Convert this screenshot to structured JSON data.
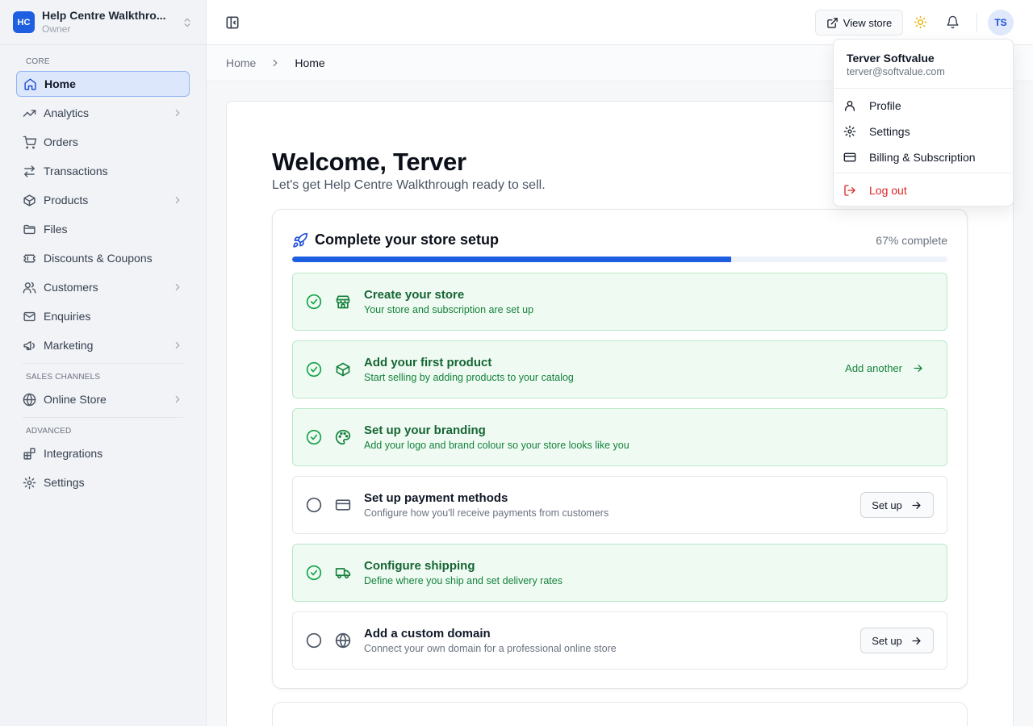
{
  "store": {
    "initials": "HC",
    "name": "Help Centre Walkthro...",
    "role": "Owner"
  },
  "sidebar": {
    "sections": [
      {
        "label": "CORE",
        "items": [
          {
            "label": "Home",
            "icon": "home-icon",
            "active": true,
            "chevron": false
          },
          {
            "label": "Analytics",
            "icon": "trending-up-icon",
            "chevron": true
          },
          {
            "label": "Orders",
            "icon": "cart-icon",
            "chevron": false
          },
          {
            "label": "Transactions",
            "icon": "arrows-swap-icon",
            "chevron": false
          },
          {
            "label": "Products",
            "icon": "box-icon",
            "chevron": true
          },
          {
            "label": "Files",
            "icon": "folder-icon",
            "chevron": false
          },
          {
            "label": "Discounts & Coupons",
            "icon": "ticket-icon",
            "chevron": false
          },
          {
            "label": "Customers",
            "icon": "users-icon",
            "chevron": true
          },
          {
            "label": "Enquiries",
            "icon": "mail-icon",
            "chevron": false
          },
          {
            "label": "Marketing",
            "icon": "megaphone-icon",
            "chevron": true
          }
        ]
      },
      {
        "label": "SALES CHANNELS",
        "items": [
          {
            "label": "Online Store",
            "icon": "globe-icon",
            "chevron": true
          }
        ]
      },
      {
        "label": "ADVANCED",
        "items": [
          {
            "label": "Integrations",
            "icon": "blocks-icon",
            "chevron": false
          },
          {
            "label": "Settings",
            "icon": "gear-icon",
            "chevron": false
          }
        ]
      }
    ]
  },
  "topbar": {
    "view_store": "View store",
    "avatar_initials": "TS"
  },
  "breadcrumb": {
    "root": "Home",
    "current": "Home"
  },
  "welcome": {
    "title": "Welcome, Terver",
    "subtitle": "Let's get Help Centre Walkthrough ready to sell."
  },
  "setup": {
    "title": "Complete your store setup",
    "progress_label": "67% complete",
    "progress_fraction": 0.67,
    "steps": [
      {
        "title": "Create your store",
        "desc": "Your store and subscription are set up",
        "done": true,
        "icon": "store-icon"
      },
      {
        "title": "Add your first product",
        "desc": "Start selling by adding products to your catalog",
        "done": true,
        "icon": "box-icon",
        "action": "Add another"
      },
      {
        "title": "Set up your branding",
        "desc": "Add your logo and brand colour so your store looks like you",
        "done": true,
        "icon": "palette-icon"
      },
      {
        "title": "Set up payment methods",
        "desc": "Configure how you'll receive payments from customers",
        "done": false,
        "icon": "credit-card-icon",
        "action": "Set up"
      },
      {
        "title": "Configure shipping",
        "desc": "Define where you ship and set delivery rates",
        "done": true,
        "icon": "truck-icon"
      },
      {
        "title": "Add a custom domain",
        "desc": "Connect your own domain for a professional online store",
        "done": false,
        "icon": "globe-icon",
        "action": "Set up"
      }
    ]
  },
  "user_menu": {
    "name": "Terver Softvalue",
    "email": "terver@softvalue.com",
    "items": [
      "Profile",
      "Settings",
      "Billing & Subscription"
    ],
    "logout": "Log out"
  },
  "colors": {
    "accent": "#1d5fe0",
    "success": "#16a34a",
    "danger": "#dc2626"
  }
}
